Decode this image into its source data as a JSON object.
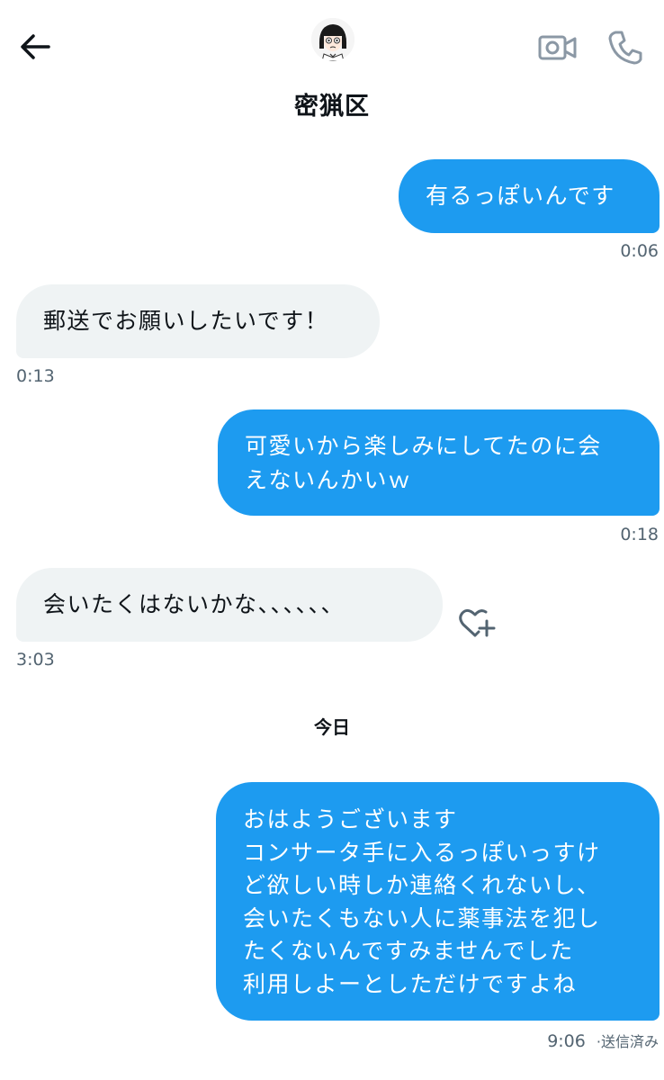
{
  "header": {
    "contact_name": "密猟区"
  },
  "messages": [
    {
      "direction": "out",
      "lines": [
        "有るっぽいんです"
      ],
      "time": "0:06"
    },
    {
      "direction": "in",
      "lines": [
        "郵送でお願いしたいです！"
      ],
      "time": "0:13"
    },
    {
      "direction": "out",
      "lines": [
        "可愛いから楽しみにしてたのに会",
        "えないんかいｗ"
      ],
      "time": "0:18"
    },
    {
      "direction": "in",
      "lines": [
        "会いたくはないかな、、、、、、"
      ],
      "time": "3:03"
    },
    {
      "direction": "out",
      "lines": [
        "おはようございます",
        "コンサータ手に入るっぽいっすけ",
        "ど欲しい時しか連絡くれないし、",
        "会いたくもない人に薬事法を犯し",
        "たくないんですみませんでした",
        "利用しよーとしただけですよね"
      ],
      "time": "9:06",
      "status": "·送信済み"
    }
  ],
  "day_separator": "今日",
  "colors": {
    "outgoing_bubble": "#1d9bf0",
    "incoming_bubble": "#eff3f4",
    "timestamp": "#536471"
  },
  "icons": [
    "back-arrow-icon",
    "video-call-icon",
    "phone-icon",
    "add-reaction-icon"
  ]
}
